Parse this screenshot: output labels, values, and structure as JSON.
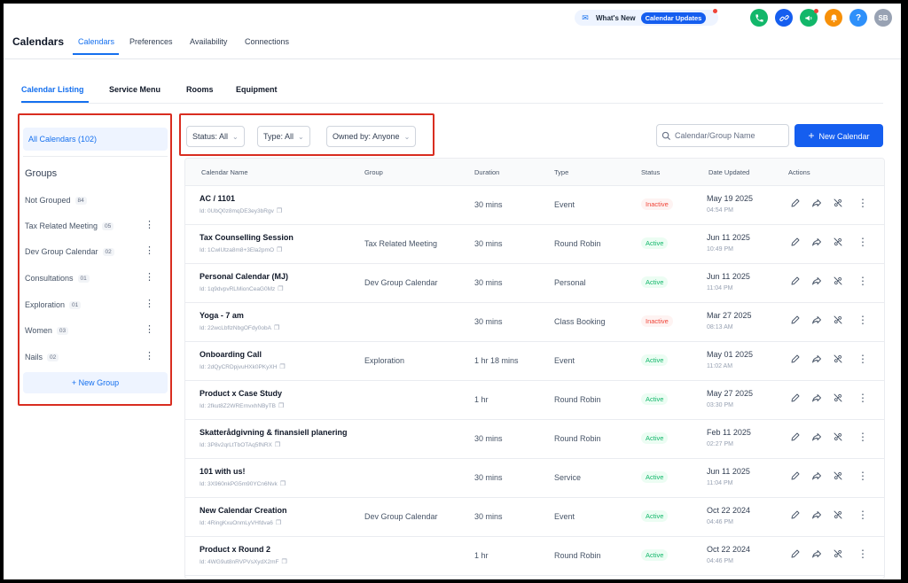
{
  "header": {
    "app_title": "Calendars",
    "tabs": [
      {
        "label": "Calendars",
        "active": true
      },
      {
        "label": "Preferences",
        "active": false
      },
      {
        "label": "Availability",
        "active": false
      },
      {
        "label": "Connections",
        "active": false
      }
    ],
    "whats_new": "What's New",
    "calendar_updates": "Calendar Updates",
    "avatar_initials": "SB",
    "help_glyph": "?",
    "icon_colors": {
      "phone": "#12b76a",
      "link": "#155eef",
      "megaphone": "#12b76a",
      "bell": "#f79009",
      "help": "#2e90fa",
      "avatar": "#98a2b3"
    }
  },
  "subtabs": [
    {
      "label": "Calendar Listing",
      "active": true
    },
    {
      "label": "Service Menu",
      "active": false
    },
    {
      "label": "Rooms",
      "active": false
    },
    {
      "label": "Equipment",
      "active": false
    }
  ],
  "sidebar": {
    "all_calendars": "All Calendars (102)",
    "groups_heading": "Groups",
    "groups": [
      {
        "label": "Not Grouped",
        "count": "84"
      },
      {
        "label": "Tax Related Meeting",
        "count": "05"
      },
      {
        "label": "Dev Group Calendar",
        "count": "02"
      },
      {
        "label": "Consultations",
        "count": "01"
      },
      {
        "label": "Exploration",
        "count": "01"
      },
      {
        "label": "Women",
        "count": "03"
      },
      {
        "label": "Nails",
        "count": "02"
      }
    ],
    "new_group": "+ New Group"
  },
  "filters": {
    "status": "Status: All",
    "type": "Type: All",
    "owned_by": "Owned by: Anyone"
  },
  "search": {
    "placeholder": "Calendar/Group Name"
  },
  "new_calendar": "New Calendar",
  "table": {
    "columns": [
      "Calendar Name",
      "Group",
      "Duration",
      "Type",
      "Status",
      "Date Updated",
      "Actions"
    ],
    "rows": [
      {
        "name": "AC / 1101",
        "id": "Id: 0UbQ0z8mqDE3ey3bRgv",
        "group": "",
        "duration": "30 mins",
        "type": "Event",
        "status": "Inactive",
        "date": "May 19 2025",
        "time": "04:54 PM"
      },
      {
        "name": "Tax Counselling Session",
        "id": "Id: 1CwlUtza8m8+3Ela2pmO",
        "group": "Tax Related Meeting",
        "duration": "30 mins",
        "type": "Round Robin",
        "status": "Active",
        "date": "Jun 11 2025",
        "time": "10:49 PM"
      },
      {
        "name": "Personal Calendar (MJ)",
        "id": "Id: 1q9dvpvRLMionCeaG0Mz",
        "group": "Dev Group Calendar",
        "duration": "30 mins",
        "type": "Personal",
        "status": "Active",
        "date": "Jun 11 2025",
        "time": "11:04 PM"
      },
      {
        "name": "Yoga - 7 am",
        "id": "Id: 22wcLbflzNbgOFdy0obA",
        "group": "",
        "duration": "30 mins",
        "type": "Class Booking",
        "status": "Inactive",
        "date": "Mar 27 2025",
        "time": "08:13 AM"
      },
      {
        "name": "Onboarding Call",
        "id": "Id: 2dQyCRDpjvuHXk0PKyXH",
        "group": "Exploration",
        "duration": "1 hr 18 mins",
        "type": "Event",
        "status": "Active",
        "date": "May 01 2025",
        "time": "11:02 AM"
      },
      {
        "name": "Product x Case Study",
        "id": "Id: 2fkut8Z2WRErnvxhNByTB",
        "group": "",
        "duration": "1 hr",
        "type": "Round Robin",
        "status": "Active",
        "date": "May 27 2025",
        "time": "03:30 PM"
      },
      {
        "name": "Skatterådgivning & finansiell planering",
        "id": "Id: 3P8v2qrLtTbOTAq5fNRX",
        "group": "",
        "duration": "30 mins",
        "type": "Round Robin",
        "status": "Active",
        "date": "Feb 11 2025",
        "time": "02:27 PM"
      },
      {
        "name": "101 with us!",
        "id": "Id: 3X960nkPG5m90YCn6Nvk",
        "group": "",
        "duration": "30 mins",
        "type": "Service",
        "status": "Active",
        "date": "Jun 11 2025",
        "time": "11:04 PM"
      },
      {
        "name": "New Calendar Creation",
        "id": "Id: 4RingKxuOnmLyVHfdva6",
        "group": "Dev Group Calendar",
        "duration": "30 mins",
        "type": "Event",
        "status": "Active",
        "date": "Oct 22 2024",
        "time": "04:46 PM"
      },
      {
        "name": "Product x Round 2",
        "id": "Id: 4WG9ut8nRVPVsXydX2mF",
        "group": "",
        "duration": "1 hr",
        "type": "Round Robin",
        "status": "Active",
        "date": "Oct 22 2024",
        "time": "04:46 PM"
      }
    ]
  }
}
